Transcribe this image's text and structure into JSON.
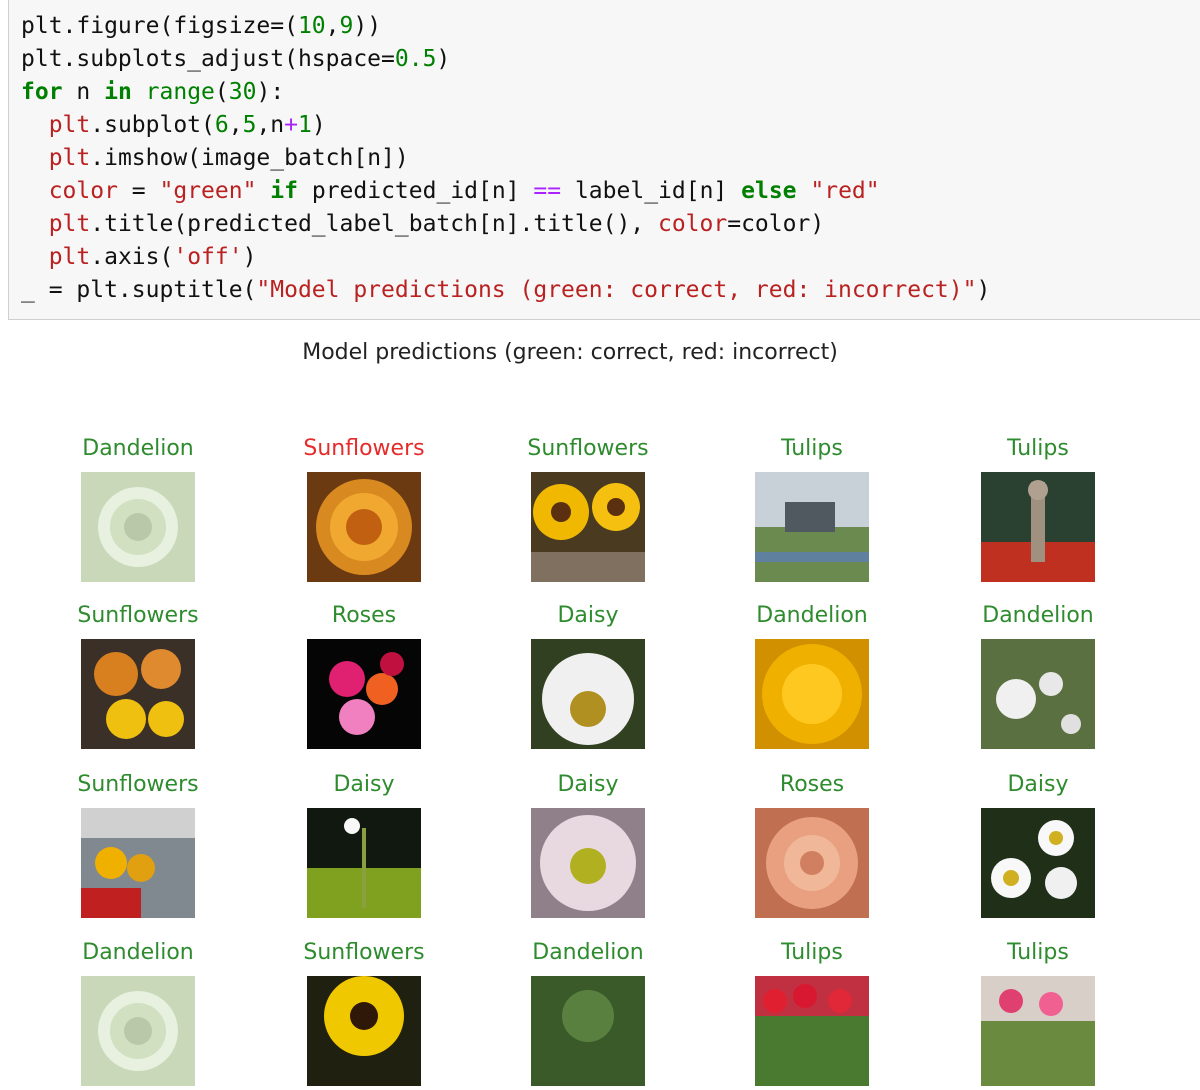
{
  "code_lines": [
    "plt.figure(figsize=(10,9))",
    "plt.subplots_adjust(hspace=0.5)",
    "for n in range(30):",
    "  plt.subplot(6,5,n+1)",
    "  plt.imshow(image_batch[n])",
    "  color = \"green\" if predicted_id[n] == label_id[n] else \"red\"",
    "  plt.title(predicted_label_batch[n].title(), color=color)",
    "  plt.axis('off')",
    "_ = plt.suptitle(\"Model predictions (green: correct, red: incorrect)\")"
  ],
  "suptitle": "Model predictions (green: correct, red: incorrect)",
  "colors": {
    "correct": "#2e8b2e",
    "incorrect": "#e62b2b",
    "cell_bg": "#f7f7f7"
  },
  "predictions": [
    {
      "label": "Dandelion",
      "correct": true,
      "image": "dandelion seed head"
    },
    {
      "label": "Sunflowers",
      "correct": false,
      "image": "orange rose"
    },
    {
      "label": "Sunflowers",
      "correct": true,
      "image": "sunflowers"
    },
    {
      "label": "Tulips",
      "correct": true,
      "image": "village with canal"
    },
    {
      "label": "Tulips",
      "correct": true,
      "image": "garden with statue"
    },
    {
      "label": "Sunflowers",
      "correct": true,
      "image": "pumpkins and sunflowers"
    },
    {
      "label": "Roses",
      "correct": true,
      "image": "rose bouquet"
    },
    {
      "label": "Daisy",
      "correct": true,
      "image": "white daisy"
    },
    {
      "label": "Dandelion",
      "correct": true,
      "image": "yellow dandelion"
    },
    {
      "label": "Dandelion",
      "correct": true,
      "image": "dandelion puffs"
    },
    {
      "label": "Sunflowers",
      "correct": true,
      "image": "sunflowers by building"
    },
    {
      "label": "Daisy",
      "correct": true,
      "image": "daisy in meadow"
    },
    {
      "label": "Daisy",
      "correct": true,
      "image": "pink daisy"
    },
    {
      "label": "Roses",
      "correct": true,
      "image": "peach rose"
    },
    {
      "label": "Daisy",
      "correct": true,
      "image": "daisies"
    },
    {
      "label": "Dandelion",
      "correct": true,
      "image": "dandelion seed head"
    },
    {
      "label": "Sunflowers",
      "correct": true,
      "image": "sunflower"
    },
    {
      "label": "Dandelion",
      "correct": true,
      "image": "green dandelion"
    },
    {
      "label": "Tulips",
      "correct": true,
      "image": "red tulips"
    },
    {
      "label": "Tulips",
      "correct": true,
      "image": "pink tulips"
    }
  ]
}
